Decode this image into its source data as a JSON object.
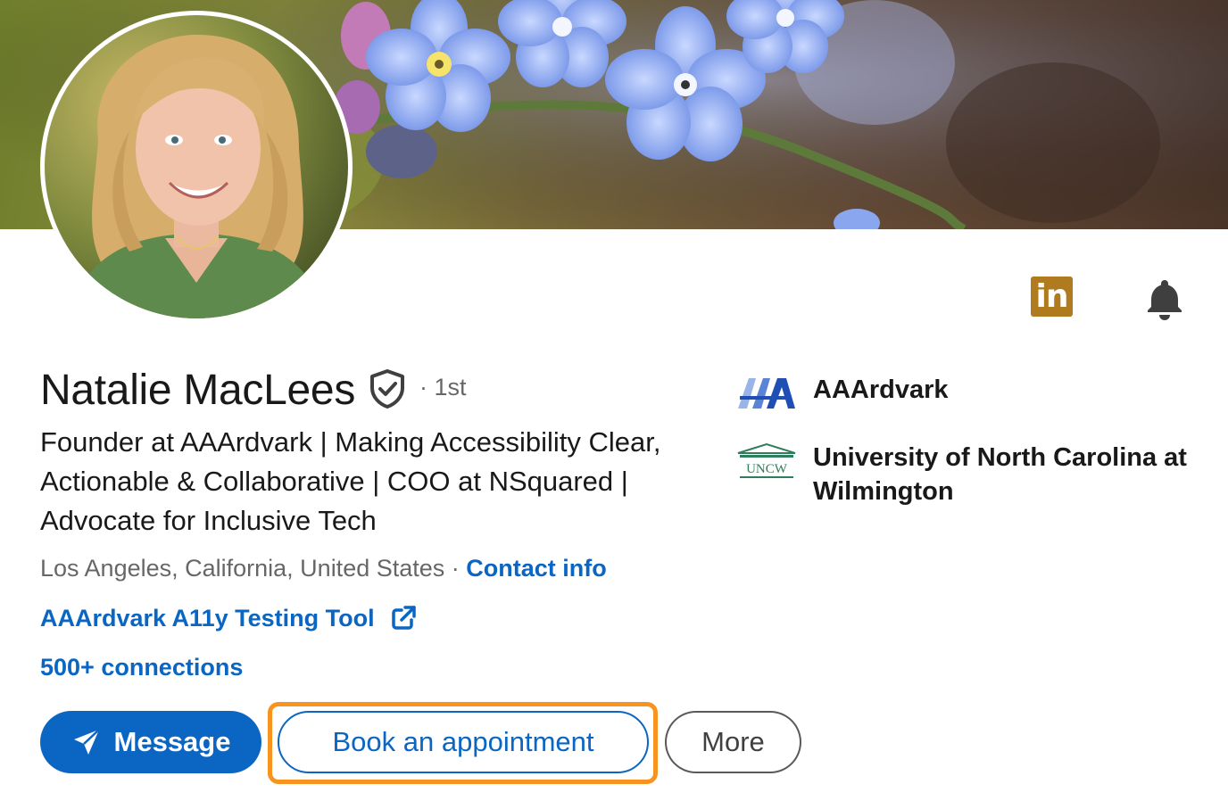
{
  "profile": {
    "name": "Natalie MacLees",
    "degree": "· 1st",
    "headline": "Founder at AAArdvark | Making Accessibility Clear, Actionable & Collaborative | COO at NSquared | Advocate for Inclusive Tech",
    "location": "Los Angeles, California, United States",
    "location_separator": " · ",
    "contact_info_label": "Contact info",
    "website_label": "AAArdvark A11y Testing Tool",
    "connections_label": "500+ connections"
  },
  "actions": {
    "message_label": "Message",
    "book_label": "Book an appointment",
    "more_label": "More"
  },
  "badges": {
    "linkedin_label": "in"
  },
  "sidebar": {
    "company": {
      "name": "AAArdvark",
      "logo_text": "AAA"
    },
    "school": {
      "name": "University of North Carolina at Wilmington",
      "logo_text": "UNCW"
    }
  },
  "icons": {
    "verified": "shield-check-icon",
    "bell": "bell-icon",
    "external_link": "external-link-icon",
    "send": "send-icon",
    "linkedin": "linkedin-premium-icon"
  },
  "colors": {
    "link": "#0a66c2",
    "primary_button": "#0a66c2",
    "focus_ring": "#f7931e",
    "linkedin_badge": "#b07a1e"
  }
}
